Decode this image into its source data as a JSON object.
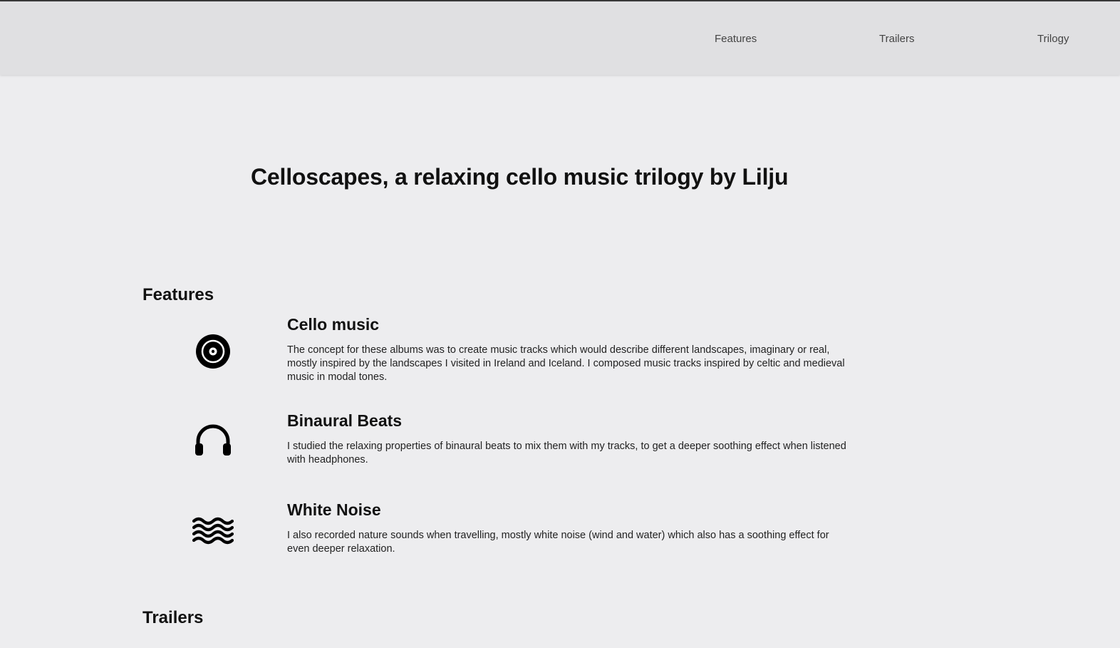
{
  "nav": {
    "links": [
      "Features",
      "Trailers",
      "Trilogy"
    ]
  },
  "hero": {
    "title": "Celloscapes, a relaxing cello music trilogy by Lilju"
  },
  "sections": {
    "features_heading": "Features",
    "trailers_heading": "Trailers"
  },
  "features": [
    {
      "icon": "vinyl-record-icon",
      "title": "Cello music",
      "text": "The concept for these albums was to create music tracks which would describe different landscapes, imaginary or real, mostly inspired by the landscapes I visited in Ireland and Iceland. I composed music tracks inspired by celtic and medieval music in modal tones."
    },
    {
      "icon": "headphones-icon",
      "title": "Binaural Beats",
      "text": "I studied the relaxing properties of binaural beats to mix them with my tracks, to get a deeper soothing effect when listened with headphones."
    },
    {
      "icon": "waves-icon",
      "title": "White Noise",
      "text": "I also recorded nature sounds when travelling, mostly white noise (wind and water) which also has a soothing effect for even deeper relaxation."
    }
  ],
  "colors": {
    "background": "#ededef",
    "navbar": "#e0e0e2",
    "text": "#111111",
    "nav_text": "#444444"
  }
}
